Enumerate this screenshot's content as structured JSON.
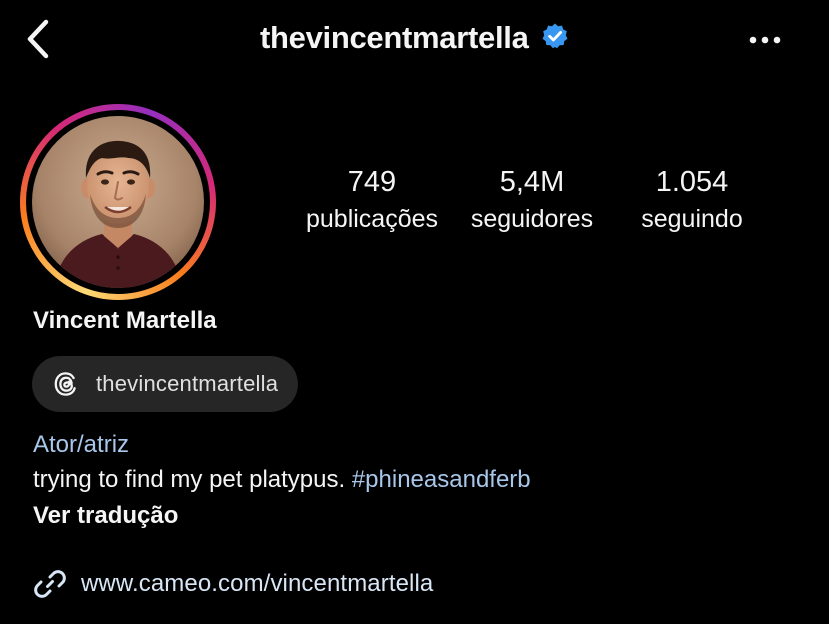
{
  "header": {
    "username": "thevincentmartella",
    "back_icon": "chevron-left-icon",
    "verified_icon": "verified-badge-icon",
    "more_icon": "more-horizontal-icon"
  },
  "profile": {
    "avatar": "profile-photo",
    "full_name": "Vincent Martella"
  },
  "stats": {
    "posts_value": "749",
    "posts_label": "publicações",
    "followers_value": "5,4M",
    "followers_label": "seguidores",
    "following_value": "1.054",
    "following_label": "seguindo"
  },
  "threads": {
    "icon": "threads-icon",
    "label": "thevincentmartella"
  },
  "bio": {
    "category": "Ator/atriz",
    "text": "trying to find my pet platypus. ",
    "hashtag": "#phineasandferb",
    "translate_label": "Ver tradução"
  },
  "link": {
    "icon": "link-icon",
    "url": "www.cameo.com/vincentmartella"
  },
  "colors": {
    "background": "#000000",
    "text": "#f5f5f5",
    "link_blue": "#a8c7ea",
    "verified_blue": "#3897f0",
    "chip_bg": "#262626"
  }
}
